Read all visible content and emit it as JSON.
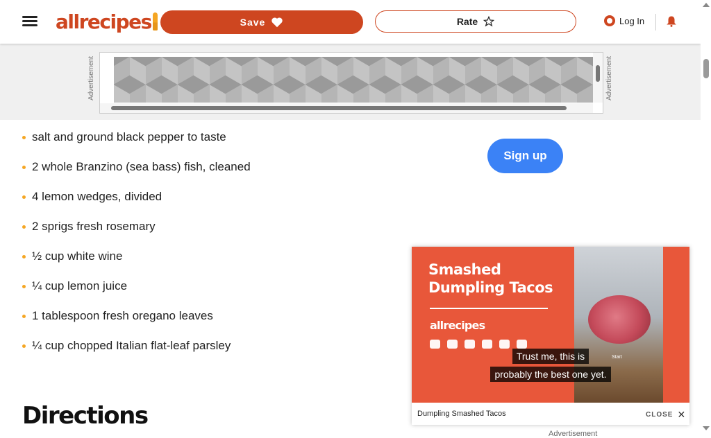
{
  "header": {
    "logo_text": "allrecipes",
    "save_label": "Save",
    "rate_label": "Rate",
    "login_label": "Log In"
  },
  "ad": {
    "label": "Advertisement"
  },
  "ingredients": [
    "salt and ground black pepper to taste",
    "2 whole Branzino (sea bass) fish, cleaned",
    "4 lemon wedges, divided",
    "2 sprigs fresh rosemary",
    "½ cup white wine",
    "¼ cup lemon juice",
    "1 tablespoon fresh oregano leaves",
    "¼ cup chopped Italian flat-leaf parsley"
  ],
  "signup_label": "Sign up",
  "directions_heading": "Directions",
  "video": {
    "title": "Smashed Dumpling Tacos",
    "brand": "allrecipes",
    "thumb_label": "Start",
    "caption_line1": "Trust me, this is",
    "caption_line2": "probably the best one yet.",
    "name": "Dumpling Smashed Tacos",
    "close_label": "CLOSE",
    "advertisement_label": "Advertisement"
  },
  "colors": {
    "brand": "#ce4620",
    "accent_yellow": "#f5a623",
    "signup_blue": "#3b82f6"
  }
}
